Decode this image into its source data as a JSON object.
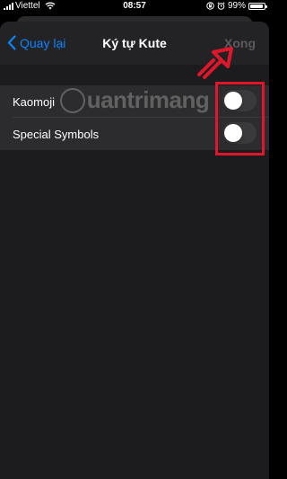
{
  "status_bar": {
    "carrier": "Viettel",
    "time": "08:57",
    "battery_percent": "99%"
  },
  "nav": {
    "back_label": "Quay lại",
    "title": "Ký tự Kute",
    "done_label": "Xong"
  },
  "settings": [
    {
      "label": "Kaomoji",
      "enabled": false
    },
    {
      "label": "Special Symbols",
      "enabled": false
    }
  ],
  "colors": {
    "accent": "#0a84ff",
    "annotation": "#e0162b",
    "toggle_off": "#3a3a3c"
  },
  "watermark": {
    "text": "uantrimang"
  }
}
